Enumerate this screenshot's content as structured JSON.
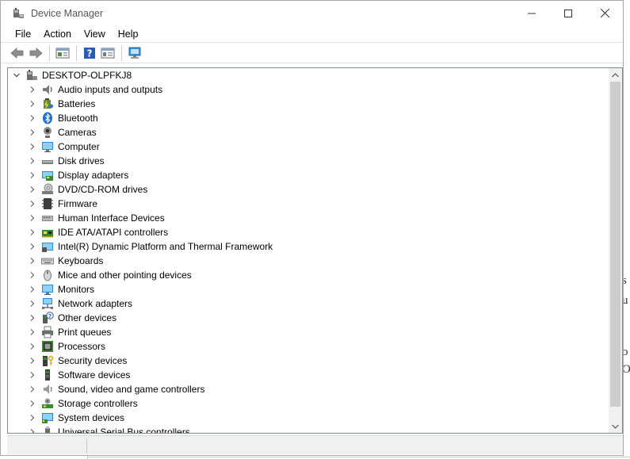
{
  "window": {
    "title": "Device Manager",
    "controls": {
      "minimize": "—",
      "maximize": "☐",
      "close": "✕"
    }
  },
  "menu": [
    "File",
    "Action",
    "View",
    "Help"
  ],
  "toolbar": [
    "back-icon",
    "forward-icon",
    "show-hide-console-tree-icon",
    "help-icon",
    "properties-icon",
    "scan-hardware-icon"
  ],
  "tree": {
    "root": "DESKTOP-OLPFKJ8",
    "categories": [
      {
        "label": "Audio inputs and outputs",
        "icon": "speaker-icon"
      },
      {
        "label": "Batteries",
        "icon": "battery-icon"
      },
      {
        "label": "Bluetooth",
        "icon": "bluetooth-icon"
      },
      {
        "label": "Cameras",
        "icon": "camera-icon"
      },
      {
        "label": "Computer",
        "icon": "computer-icon"
      },
      {
        "label": "Disk drives",
        "icon": "disk-drive-icon"
      },
      {
        "label": "Display adapters",
        "icon": "display-adapter-icon"
      },
      {
        "label": "DVD/CD-ROM drives",
        "icon": "dvd-drive-icon"
      },
      {
        "label": "Firmware",
        "icon": "firmware-icon"
      },
      {
        "label": "Human Interface Devices",
        "icon": "hid-icon"
      },
      {
        "label": "IDE ATA/ATAPI controllers",
        "icon": "ide-controller-icon"
      },
      {
        "label": "Intel(R) Dynamic Platform and Thermal Framework",
        "icon": "thermal-icon"
      },
      {
        "label": "Keyboards",
        "icon": "keyboard-icon"
      },
      {
        "label": "Mice and other pointing devices",
        "icon": "mouse-icon"
      },
      {
        "label": "Monitors",
        "icon": "monitor-icon"
      },
      {
        "label": "Network adapters",
        "icon": "network-adapter-icon"
      },
      {
        "label": "Other devices",
        "icon": "other-devices-icon"
      },
      {
        "label": "Print queues",
        "icon": "printer-icon"
      },
      {
        "label": "Processors",
        "icon": "processor-icon"
      },
      {
        "label": "Security devices",
        "icon": "security-device-icon"
      },
      {
        "label": "Software devices",
        "icon": "software-device-icon"
      },
      {
        "label": "Sound, video and game controllers",
        "icon": "sound-controller-icon"
      },
      {
        "label": "Storage controllers",
        "icon": "storage-controller-icon"
      },
      {
        "label": "System devices",
        "icon": "system-devices-icon"
      },
      {
        "label": "Universal Serial Bus controllers",
        "icon": "usb-controller-icon"
      }
    ]
  },
  "background_fragments": [
    "s",
    "u",
    "o",
    "O"
  ]
}
